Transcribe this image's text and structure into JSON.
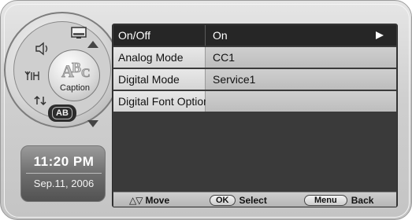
{
  "menu": {
    "rows": [
      {
        "label": "On/Off",
        "value": "On",
        "active": true
      },
      {
        "label": "Analog Mode",
        "value": "CC1"
      },
      {
        "label": "Digital Mode",
        "value": "Service1"
      },
      {
        "label": "Digital Font Option",
        "value": ""
      }
    ]
  },
  "dial": {
    "center_label": "Caption",
    "selected_item": "AB",
    "items": {
      "top": "screen-icon",
      "upper_left": "speaker-icon",
      "left": "antenna-icon",
      "lower_left": "input-icon",
      "bottom": "AB"
    }
  },
  "clock": {
    "time": "11:20 PM",
    "date": "Sep.11, 2006"
  },
  "help_bar": {
    "move_glyphs": "△▽",
    "move_label": "Move",
    "ok_key": "OK",
    "select_label": "Select",
    "menu_key": "Menu",
    "back_label": "Back"
  },
  "colors": {
    "panel_bg": "#3a3a3a",
    "active_row": "#262626",
    "normal_row": "#d2d2d2",
    "clock_bg": "#6e6e6e"
  }
}
